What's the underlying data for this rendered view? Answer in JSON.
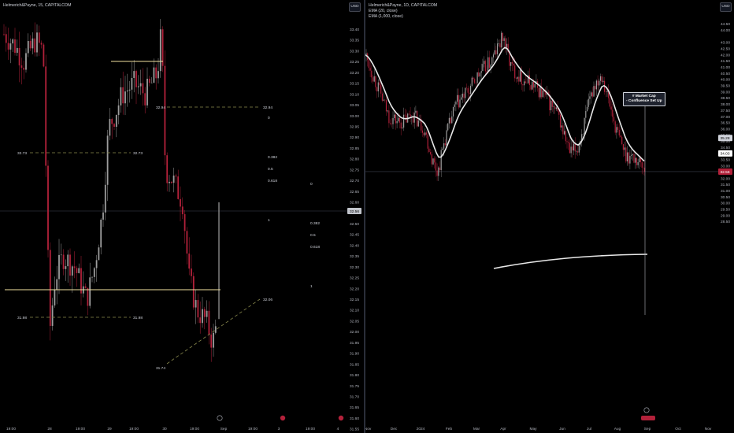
{
  "left_chart": {
    "title": "Helmerich&Payne, 15, CAPITALCOM",
    "currency": "USD",
    "price_axis_labels": [
      "33.40",
      "33.35",
      "33.30",
      "33.25",
      "33.20",
      "33.15",
      "33.10",
      "33.05",
      "33.00",
      "32.95",
      "32.90",
      "32.85",
      "32.80",
      "32.75",
      "32.70",
      "32.65",
      "32.60",
      "32.55",
      "32.50",
      "32.45",
      "32.40",
      "32.35",
      "32.30",
      "32.25",
      "32.20",
      "32.15",
      "32.10",
      "32.05",
      "32.00",
      "31.95",
      "31.90",
      "31.85",
      "31.80",
      "31.75",
      "31.70",
      "31.65",
      "31.60",
      "31.55",
      "31.50"
    ],
    "current_price": "32.56",
    "time_labels": [
      "19:00",
      "28",
      "19:00",
      "29",
      "19:00",
      "30",
      "19:00",
      "Sep",
      "19:00",
      "3",
      "19:00",
      "4"
    ],
    "levels": {
      "l3294": "32.94",
      "l3273a": "32.73",
      "l3273b": "32.73",
      "l3198a": "31.98",
      "l3198b": "31.98",
      "l3206": "32.06",
      "l3174": "31.74"
    },
    "fib1": {
      "f0": "0",
      "f382": "0.382",
      "f5": "0.5",
      "f618": "0.618",
      "f1": "1"
    },
    "fib2": {
      "f0": "0",
      "f382": "0.382",
      "f5": "0.5",
      "f618": "0.618",
      "f1": "1"
    },
    "colors": {
      "up": "#9e9e9e",
      "down": "#b2213a",
      "yellow_line": "#f2e2a0",
      "dashed": "#8a8a4e",
      "price_label": "#c2c5cc"
    }
  },
  "right_chart": {
    "title": "Helmerich&Payne, 1D, CAPITALCOM",
    "indicators": [
      "EMA (20, close)",
      "EMA (1,000, close)"
    ],
    "currency": "USD",
    "price_axis_labels": [
      "44.50",
      "44.00",
      "43.00",
      "42.50",
      "42.00",
      "41.50",
      "41.00",
      "40.50",
      "40.00",
      "39.50",
      "39.00",
      "38.50",
      "38.00",
      "37.50",
      "37.00",
      "36.50",
      "36.00",
      "35.50",
      "35.00",
      "34.50",
      "34.00",
      "33.50",
      "33.00",
      "32.50",
      "32.00",
      "31.50",
      "31.00",
      "30.50",
      "30.00",
      "29.50",
      "29.00",
      "28.50"
    ],
    "ema1000_value": "35.28",
    "ema20_value": "34.03",
    "current_price": "32.56",
    "time_labels": [
      "Nov",
      "Dec",
      "2024",
      "Feb",
      "Mar",
      "Apr",
      "May",
      "Jun",
      "Jul",
      "Aug",
      "Sep",
      "Oct",
      "Nov"
    ],
    "annotation": {
      "line1": "# Market Cap",
      "line2": "- Confluence Set Up"
    },
    "colors": {
      "up": "#9e9e9e",
      "down": "#b2213a",
      "ema": "#e8e8e8",
      "badge_red": "#b2213a"
    }
  }
}
